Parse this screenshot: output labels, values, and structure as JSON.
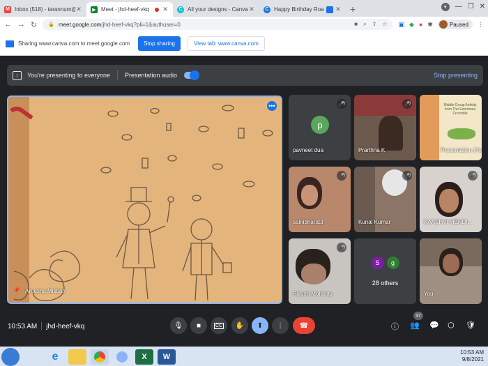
{
  "browser": {
    "tabs": [
      {
        "title": "Inbox (518) - tarannum@theindi",
        "favicon": "gmail-icon",
        "color": "#ea4335",
        "active": false
      },
      {
        "title": "Meet - jhd-heef-vkq",
        "favicon": "meet-icon",
        "color": "#00832d",
        "active": true
      },
      {
        "title": "All your designs - Canva",
        "favicon": "canva-icon",
        "color": "#00c4cc",
        "active": false
      },
      {
        "title": "Happy Birthday Roald Dahl",
        "favicon": "canva-icon",
        "color": "#1a73e8",
        "active": false
      }
    ],
    "url_host": "meet.google.com",
    "url_path": "/jhd-heef-vkq?pli=1&authuser=0",
    "profile_status": "Paused"
  },
  "sharebar": {
    "message": "Sharing www.canva.com to meet.google.com",
    "stop_label": "Stop sharing",
    "view_label": "View tab: www.canva.com"
  },
  "presenting": {
    "message": "You're presenting to everyone",
    "audio_label": "Presentation audio",
    "stop_label": "Stop presenting"
  },
  "main_video": {
    "presenter_name": "Areesha Misbah"
  },
  "tiles": [
    {
      "name": "pavneet dua",
      "avatar_letter": "p"
    },
    {
      "name": "Prarthna K"
    },
    {
      "name": "Presentation (You)",
      "poster_text": "Middle Group Activity from The Enormous Crocodile"
    },
    {
      "name": "sainibharat3"
    },
    {
      "name": "Kunal Kumar"
    },
    {
      "name": "KAASHVI MENDI..."
    },
    {
      "name": "Piyush Mohanty"
    },
    {
      "name": "28 others",
      "letters": [
        "S",
        "g"
      ]
    },
    {
      "name": "You"
    }
  ],
  "meeting": {
    "time": "10:53 AM",
    "code": "jhd-heef-vkq",
    "participant_count": "37"
  },
  "taskbar": {
    "time": "10:53 AM",
    "date": "9/8/2021"
  },
  "colors": {
    "accent": "#1a73e8",
    "end_call": "#ea4335",
    "panel": "#3c4043",
    "background": "#202124"
  }
}
